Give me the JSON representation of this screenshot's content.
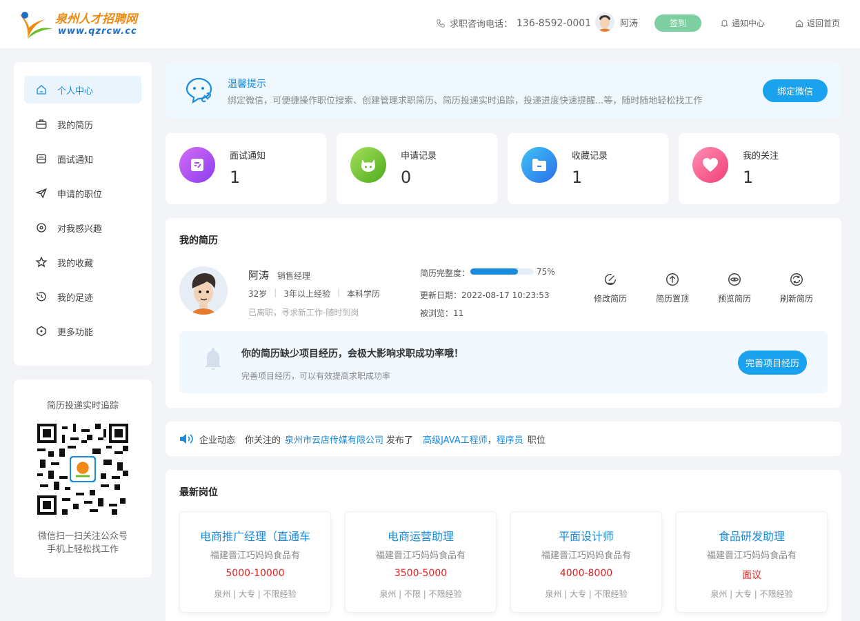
{
  "header": {
    "logo_name": "泉州人才招聘网",
    "logo_url": "www.qzrcw.cc",
    "phone_label": "求职咨询电话：",
    "phone": "136-8592-0001",
    "username": "阿涛",
    "sign_label": "签到",
    "notify_label": "通知中心",
    "home_label": "返回首页"
  },
  "sidebar": {
    "items": [
      {
        "label": "个人中心",
        "icon": "home-icon"
      },
      {
        "label": "我的简历",
        "icon": "briefcase-icon"
      },
      {
        "label": "面试通知",
        "icon": "interview-icon"
      },
      {
        "label": "申请的职位",
        "icon": "send-icon"
      },
      {
        "label": "对我感兴趣",
        "icon": "eye-circle-icon"
      },
      {
        "label": "我的收藏",
        "icon": "star-icon"
      },
      {
        "label": "我的足迹",
        "icon": "history-icon"
      },
      {
        "label": "更多功能",
        "icon": "more-icon"
      }
    ],
    "qr_title": "简历投递实时追踪",
    "qr_desc1": "微信扫一扫关注公众号",
    "qr_desc2": "手机上轻松找工作"
  },
  "tips": {
    "title": "温馨提示",
    "text": "绑定微信，可便捷操作职位搜索、创建管理求职简历、简历投递实时追踪，投递进度快速提醒...等，随时随地轻松找工作",
    "button": "绑定微信"
  },
  "stats": [
    {
      "label": "面试通知",
      "value": "1",
      "color": "#a855f7"
    },
    {
      "label": "申请记录",
      "value": "0",
      "color": "#6cc62a"
    },
    {
      "label": "收藏记录",
      "value": "1",
      "color": "#2e8ff0"
    },
    {
      "label": "我的关注",
      "value": "1",
      "color": "#f0467a"
    }
  ],
  "resume": {
    "title": "我的简历",
    "name": "阿涛",
    "position": "销售经理",
    "age": "32岁",
    "experience": "3年以上经验",
    "education": "本科学历",
    "status": "已离职，寻求新工作-随时到岗",
    "completeness_label": "简历完整度：",
    "completeness": 75,
    "completeness_text": "75%",
    "update_label": "更新日期：",
    "update_value": "2022-08-17 10:23:53",
    "views_label": "被浏览：",
    "views_value": "11",
    "actions": [
      "修改简历",
      "简历置顶",
      "预览简历",
      "刷新简历"
    ],
    "warn_title": "你的简历缺少项目经历，会极大影响求职成功率哦！",
    "warn_desc": "完善项目经历，可以有效提高求职成功率",
    "warn_button": "完善项目经历"
  },
  "news": {
    "label": "企业动态",
    "prefix": "你关注的",
    "company": "泉州市云店传媒有限公司",
    "mid": "发布了",
    "job1": "高级JAVA工程师",
    "comma": "，",
    "job2": "程序员",
    "suffix": "职位"
  },
  "jobs": {
    "title": "最新岗位",
    "items": [
      {
        "title": "电商推广经理（直通车",
        "company": "福建晋江巧妈妈食品有",
        "salary": "5000-10000",
        "meta": "泉州 | 大专 | 不限经验"
      },
      {
        "title": "电商运营助理",
        "company": "福建晋江巧妈妈食品有",
        "salary": "3500-5000",
        "meta": "泉州 | 不限 | 不限经验"
      },
      {
        "title": "平面设计师",
        "company": "福建晋江巧妈妈食品有",
        "salary": "4000-8000",
        "meta": "泉州 | 大专 | 不限经验"
      },
      {
        "title": "食品研发助理",
        "company": "福建晋江巧妈妈食品有",
        "salary": "面议",
        "meta": "泉州 | 大专 | 不限经验"
      }
    ]
  }
}
